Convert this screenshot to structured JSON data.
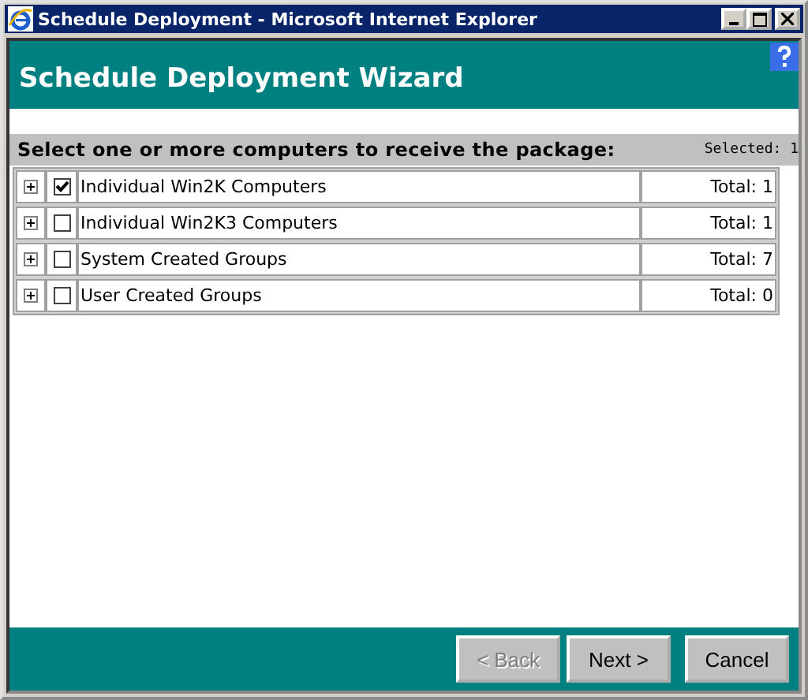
{
  "window": {
    "title": "Schedule Deployment - Microsoft Internet Explorer"
  },
  "header": {
    "title": "Schedule Deployment Wizard"
  },
  "selection_bar": {
    "prompt": "Select one or more computers to receive the package:",
    "selected_count": "Selected: 1"
  },
  "rows": [
    {
      "label": "Individual Win2K Computers",
      "total": "Total: 1",
      "checked": true
    },
    {
      "label": "Individual Win2K3 Computers",
      "total": "Total: 1",
      "checked": false
    },
    {
      "label": "System Created Groups",
      "total": "Total: 7",
      "checked": false
    },
    {
      "label": "User Created Groups",
      "total": "Total: 0",
      "checked": false
    }
  ],
  "buttons": [
    {
      "label": "< Back",
      "disabled": true
    },
    {
      "label": "Next >",
      "disabled": false
    },
    {
      "label": "Cancel",
      "disabled": false
    }
  ]
}
